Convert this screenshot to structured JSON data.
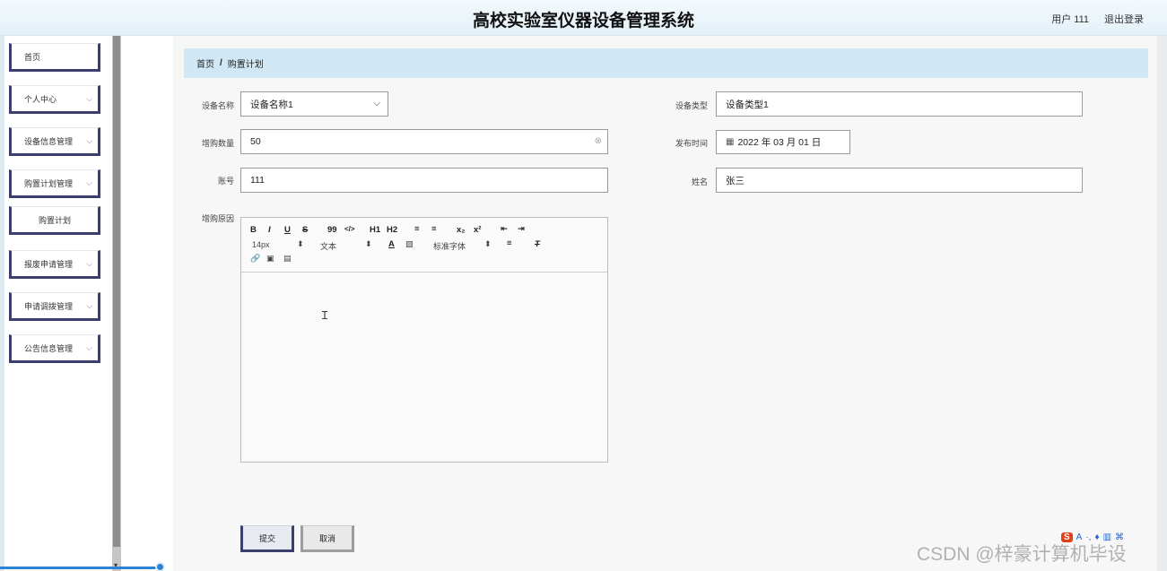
{
  "header": {
    "title": "高校实验室仪器设备管理系统",
    "user": "用户 111",
    "logout": "退出登录"
  },
  "sidebar": {
    "items": [
      {
        "label": "首页",
        "has_arrow": false
      },
      {
        "label": "个人中心",
        "has_arrow": true
      },
      {
        "label": "设备信息管理",
        "has_arrow": true
      },
      {
        "label": "购置计划管理",
        "has_arrow": true
      },
      {
        "label": "购置计划",
        "sub": true
      },
      {
        "label": "报废申请管理",
        "has_arrow": true
      },
      {
        "label": "申请调拨管理",
        "has_arrow": true
      },
      {
        "label": "公告信息管理",
        "has_arrow": true
      }
    ]
  },
  "breadcrumb": {
    "home": "首页",
    "sep": "/",
    "current": "购置计划"
  },
  "form": {
    "device_name": {
      "label": "设备名称",
      "value": "设备名称1"
    },
    "device_type": {
      "label": "设备类型",
      "value": "设备类型1"
    },
    "purchase_qty": {
      "label": "增购数量",
      "value": "50"
    },
    "publish_time": {
      "label": "发布时间",
      "value": "2022 年 03 月 01 日"
    },
    "account": {
      "label": "账号",
      "value": "111"
    },
    "name": {
      "label": "姓名",
      "value": "张三"
    },
    "reason": {
      "label": "增购原因"
    }
  },
  "editor": {
    "row1": [
      "B",
      "I",
      "U",
      "S",
      "99",
      "</>",
      "H1",
      "H2",
      "≡",
      "≡",
      "x₂",
      "x²",
      "⇤",
      "⇥"
    ],
    "font_size": "14px",
    "header_select": "文本",
    "font_family": "标准字体",
    "row3": [
      "🔗",
      "▣",
      "▤"
    ]
  },
  "buttons": {
    "submit": "提交",
    "cancel": "取消"
  },
  "watermark": "CSDN @梓豪计算机毕设",
  "colors": {
    "sidebar_border": "#3b3f6e",
    "breadcrumb_bg": "#d0e8f5",
    "header_bg": "#e3f1f8"
  }
}
